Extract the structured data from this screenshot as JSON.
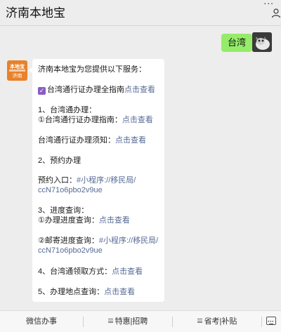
{
  "header": {
    "title": "济南本地宝",
    "more_glyph": "...",
    "more_icon": "more-icon",
    "person_icon": "person-icon"
  },
  "chat": {
    "user_message": "台湾",
    "bot_avatar": {
      "top_text": "本地宝",
      "bottom_text": "济南"
    },
    "bot_lines": {
      "intro": "济南本地宝为您提供以下服务：",
      "guide_text": "台湾通行证办理全指南",
      "guide_link": "点击查看",
      "s1_title": "1、台湾通办理：",
      "s1_item_text": "①台湾通行证办理指南：",
      "s1_item_link": "点击查看",
      "s1_notice_text": "台湾通行证办理须知：",
      "s1_notice_link": "点击查看",
      "s2_title": "2、预约办理",
      "s2_entry_text": "预约入口：",
      "s2_entry_link_1": "#小程序://移民局/",
      "s2_entry_link_2": "ccN71o6pbo2v9ue",
      "s3_title": "3、进度查询：",
      "s3_item1_text": "①办理进度查询：",
      "s3_item1_link": "点击查看",
      "s3_item2_text": "②邮寄进度查询：",
      "s3_item2_link_1": "#小程序://移民局/",
      "s3_item2_link_2": "ccN71o6pbo2v9ue",
      "s4_text": "4、台湾通领取方式：",
      "s4_link": "点击查看",
      "s5_text": "5、办理地点查询：",
      "s5_link": "点击查看"
    }
  },
  "menu": {
    "item1": "微信办事",
    "item2": "特惠|招聘",
    "item3": "省考|补贴",
    "keyboard_icon": "keyboard-icon"
  },
  "colors": {
    "background": "#ededed",
    "user_bubble": "#95ec69",
    "link": "#576b95",
    "avatar": "#e8812a"
  }
}
